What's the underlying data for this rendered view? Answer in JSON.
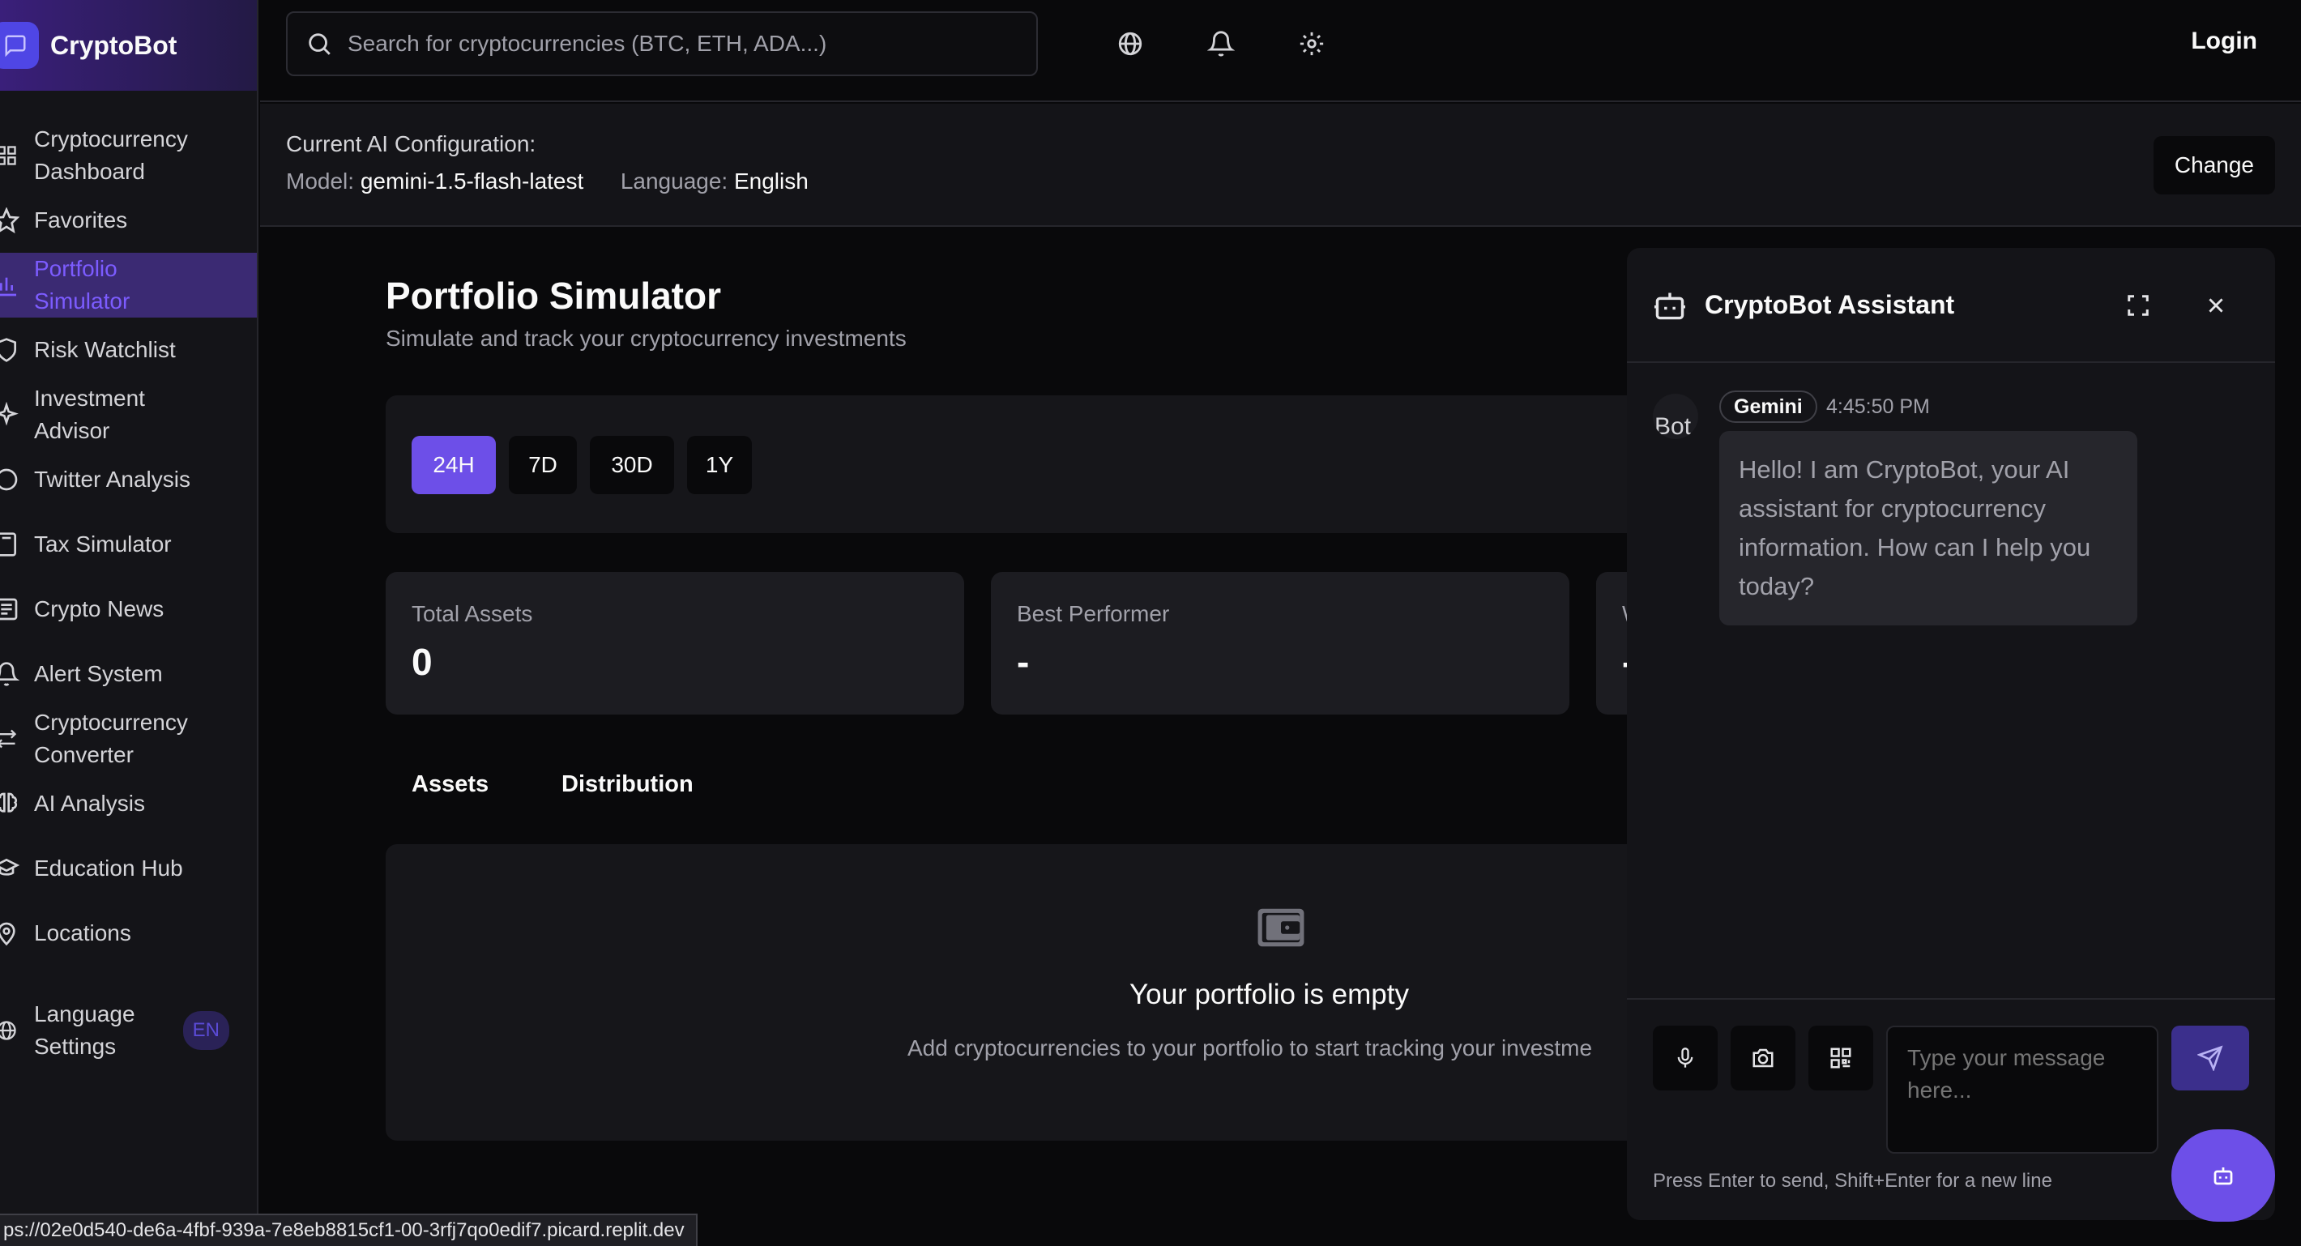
{
  "brand": {
    "title": "CryptoBot"
  },
  "search": {
    "placeholder": "Search for cryptocurrencies (BTC, ETH, ADA...)"
  },
  "header": {
    "login": "Login"
  },
  "sidebar": {
    "items": [
      {
        "label": "Cryptocurrency Dashboard",
        "icon": "grid-icon"
      },
      {
        "label": "Favorites",
        "icon": "star-icon"
      },
      {
        "label": "Portfolio Simulator",
        "icon": "bar-chart-icon",
        "active": true
      },
      {
        "label": "Risk Watchlist",
        "icon": "shield-icon"
      },
      {
        "label": "Investment Advisor",
        "icon": "sparkles-icon"
      },
      {
        "label": "Twitter Analysis",
        "icon": "message-circle-icon"
      },
      {
        "label": "Tax Simulator",
        "icon": "calculator-icon"
      },
      {
        "label": "Crypto News",
        "icon": "newspaper-icon"
      },
      {
        "label": "Alert System",
        "icon": "bell-icon"
      },
      {
        "label": "Cryptocurrency Converter",
        "icon": "arrows-exchange-icon"
      },
      {
        "label": "AI Analysis",
        "icon": "brain-icon"
      },
      {
        "label": "Education Hub",
        "icon": "graduation-cap-icon"
      },
      {
        "label": "Locations",
        "icon": "map-pin-icon"
      },
      {
        "label": "Language Settings",
        "icon": "globe-icon",
        "badge": "EN"
      }
    ]
  },
  "ai_config": {
    "title": "Current AI Configuration:",
    "model_label": "Model:",
    "model_value": "gemini-1.5-flash-latest",
    "language_label": "Language:",
    "language_value": "English",
    "change_label": "Change"
  },
  "portfolio": {
    "title": "Portfolio Simulator",
    "subtitle": "Simulate and track your cryptocurrency investments",
    "periods": [
      "24H",
      "7D",
      "30D",
      "1Y"
    ],
    "active_period": "24H",
    "stats": [
      {
        "label": "Total Assets",
        "value": "0"
      },
      {
        "label": "Best Performer",
        "value": "-"
      },
      {
        "label": "W",
        "value": "-"
      }
    ],
    "tabs": [
      "Assets",
      "Distribution"
    ],
    "empty_title": "Your portfolio is empty",
    "empty_subtitle": "Add cryptocurrencies to your portfolio to start tracking your investme"
  },
  "chat": {
    "title": "CryptoBot Assistant",
    "avatar_alt": "Bot",
    "message": {
      "sender": "Gemini",
      "time": "4:45:50 PM",
      "text": "Hello! I am CryptoBot, your AI assistant for cryptocurrency information. How can I help you today?"
    },
    "input_placeholder": "Type your message here...",
    "hint": "Press Enter to send, Shift+Enter for a new line"
  },
  "status_url": "ps://02e0d540-de6a-4fbf-939a-7e8eb8815cf1-00-3rfj7qo0edif7.picard.replit.dev",
  "colors": {
    "accent": "#6d4fe8",
    "active_nav_bg": "#3b2a73",
    "active_nav_text": "#7c5cff"
  }
}
